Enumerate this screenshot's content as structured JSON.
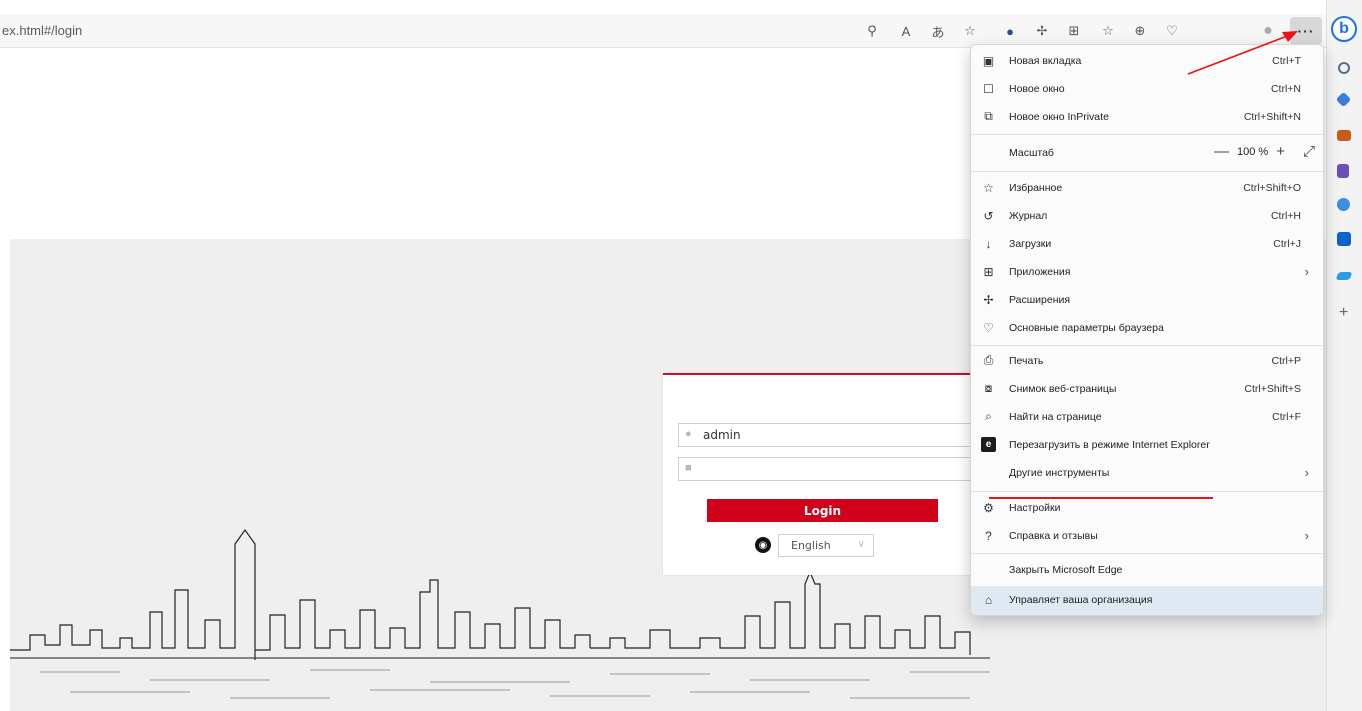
{
  "browser": {
    "url": "ex.html#/login",
    "more_label": "···",
    "sidebar_logo": "b",
    "toolbar_icons": [
      "key-icon",
      "read-aloud-icon",
      "translate-icon",
      "favorite-star-icon",
      "extension-g-icon",
      "puzzle-icon",
      "split-screen-icon",
      "favorites-bar-icon",
      "collections-icon",
      "heart-pulse-icon",
      "profile-avatar-icon"
    ],
    "toolbar_glyphs": [
      "⚲",
      "A",
      "あ",
      "☆",
      "●",
      "✢",
      "⊞",
      "☆",
      "⊕",
      "♡",
      "●"
    ],
    "sidebar_icons": [
      {
        "name": "search-icon",
        "color": "#5a6b8c"
      },
      {
        "name": "tag-icon",
        "color": "#3b7ddd"
      },
      {
        "name": "toolbox-icon",
        "color": "#c85a1e"
      },
      {
        "name": "games-icon",
        "color": "#6b4fbb"
      },
      {
        "name": "copilot-icon",
        "color": "#3a8ee6"
      },
      {
        "name": "outlook-icon",
        "color": "#0a64c8"
      },
      {
        "name": "send-icon",
        "color": "#2e9be6"
      },
      {
        "name": "add-icon",
        "color": "#666666"
      }
    ]
  },
  "login": {
    "username": "admin",
    "password": "",
    "button_label": "Login",
    "language": "English",
    "lang_chevron": "∨"
  },
  "menu": {
    "new_tab": {
      "label": "Новая вкладка",
      "shortcut": "Ctrl+T"
    },
    "new_window": {
      "label": "Новое окно",
      "shortcut": "Ctrl+N"
    },
    "inprivate": {
      "label": "Новое окно InPrivate",
      "shortcut": "Ctrl+Shift+N"
    },
    "zoom": {
      "label": "Масштаб",
      "value": "100 %",
      "minus": "—",
      "plus": "+",
      "expand": "⤢"
    },
    "favorites": {
      "label": "Избранное",
      "shortcut": "Ctrl+Shift+O"
    },
    "history": {
      "label": "Журнал",
      "shortcut": "Ctrl+H"
    },
    "downloads": {
      "label": "Загрузки",
      "shortcut": "Ctrl+J"
    },
    "apps": {
      "label": "Приложения"
    },
    "extensions": {
      "label": "Расширения"
    },
    "essentials": {
      "label": "Основные параметры браузера"
    },
    "print": {
      "label": "Печать",
      "shortcut": "Ctrl+P"
    },
    "screenshot": {
      "label": "Снимок веб-страницы",
      "shortcut": "Ctrl+Shift+S"
    },
    "find": {
      "label": "Найти на странице",
      "shortcut": "Ctrl+F"
    },
    "ie_mode": {
      "label": "Перезагрузить в режиме Internet Explorer"
    },
    "more_tools": {
      "label": "Другие инструменты"
    },
    "settings": {
      "label": "Настройки"
    },
    "help": {
      "label": "Справка и отзывы"
    },
    "close_edge": {
      "label": "Закрыть Microsoft Edge"
    },
    "managed": {
      "label": "Управляет ваша организация"
    },
    "arrow": "›"
  },
  "colors": {
    "accent_red": "#d0021b",
    "annotation_red": "#e11111",
    "managed_row": "#dfe9f4"
  }
}
